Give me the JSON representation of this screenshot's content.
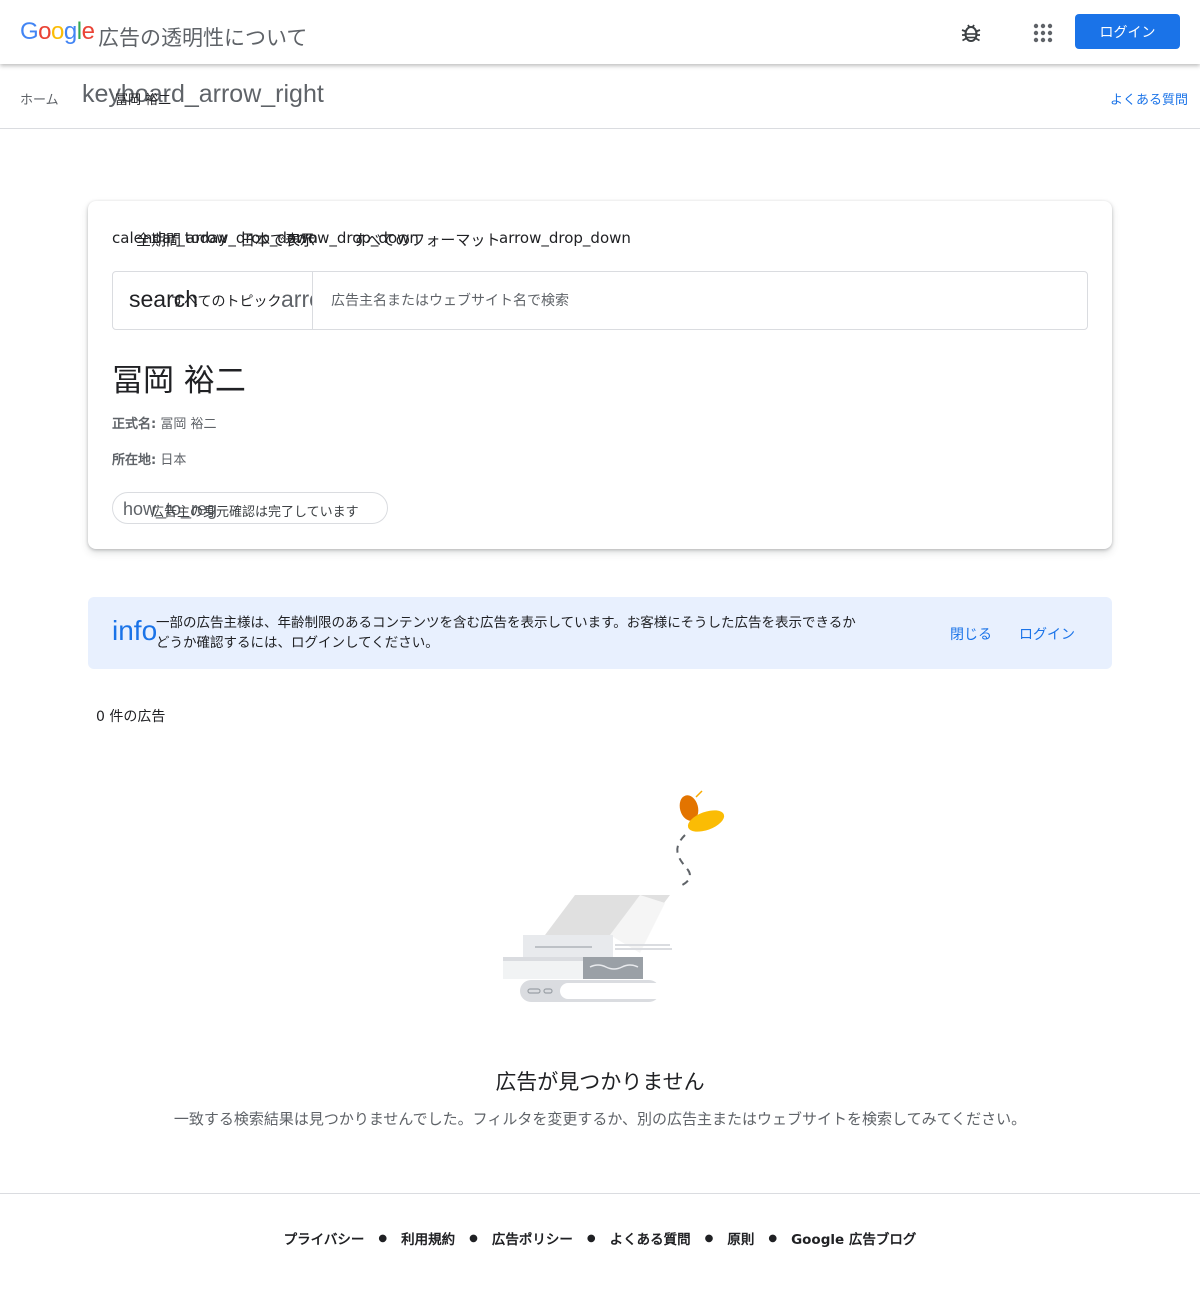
{
  "header": {
    "logo": "Google",
    "app_title": "広告の透明性について",
    "bug_icon": "bug-icon",
    "apps_icon": "apps-grid-icon",
    "login_label": "ログイン"
  },
  "breadcrumb": {
    "home": "ホーム",
    "separator_icon": "keyboard_arrow_right",
    "current": "冨岡 裕二",
    "faq": "よくある質問"
  },
  "filters": {
    "date_icon": "calendar_today",
    "date": "全期間",
    "date_arrow": "arrow_drop_down",
    "region": "日本で表示",
    "region_arrow": "arrow_drop_down",
    "format": "すべてのフォーマット",
    "format_arrow": "arrow_drop_down"
  },
  "search": {
    "icon": "search",
    "topic": "すべてのトピック",
    "topic_arrow": "arrow_drop_down",
    "placeholder": "広告主名またはウェブサイト名で検索"
  },
  "advertiser": {
    "name": "冨岡 裕二",
    "legal_label": "正式名:",
    "legal_value": "冨岡 裕二",
    "location_label": "所在地:",
    "location_value": "日本",
    "verify_icon": "how_to_reg",
    "verified": "広告主の身元確認は完了しています"
  },
  "banner": {
    "icon": "info",
    "text": "一部の広告主様は、年齢制限のあるコンテンツを含む広告を表示しています。お客様にそうした広告を表示できるかどうか確認するには、ログインしてください。",
    "close": "閉じる",
    "login": "ログイン"
  },
  "results": {
    "count": "0 件の広告"
  },
  "empty": {
    "title": "広告が見つかりません",
    "description": "一致する検索結果は見つかりませんでした。フィルタを変更するか、別の広告主またはウェブサイトを検索してみてください。"
  },
  "footer": {
    "links": [
      "プライバシー",
      "利用規約",
      "広告ポリシー",
      "よくある質問",
      "原則",
      "Google 広告ブログ"
    ]
  },
  "colors": {
    "accent": "#1a73e8",
    "banner_bg": "#e8f0fe"
  }
}
